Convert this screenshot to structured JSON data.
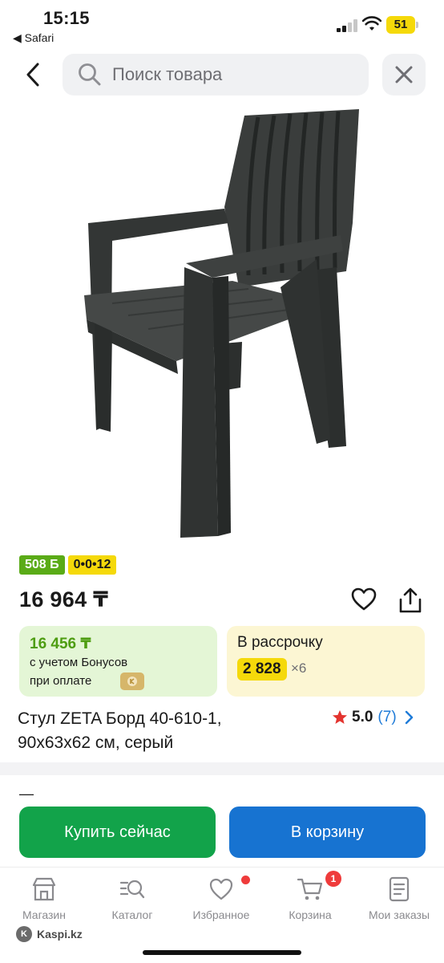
{
  "status_bar": {
    "time": "15:15",
    "back_app": "◀ Safari",
    "battery": "51"
  },
  "search": {
    "placeholder": "Поиск товара"
  },
  "badges": {
    "bonus": "508 Б",
    "installment": "0•0•12"
  },
  "price": "16 964 ₸",
  "bonus_card": {
    "price": "16 456 ₸",
    "note_line1": "с учетом Бонусов",
    "note_line2": "при оплате"
  },
  "installment_card": {
    "title": "В рассрочку",
    "amount": "2 828",
    "multiplier": "×6"
  },
  "product": {
    "title_line1": "Стул ZETA Борд 40-610-1,",
    "title_line2": "90x63x62 см, серый",
    "rating_value": "5.0",
    "rating_count": "(7)"
  },
  "sheet_dash": "—",
  "actions": {
    "buy_now": "Купить сейчас",
    "add_to_cart": "В корзину"
  },
  "tabbar": {
    "items": [
      {
        "label": "Магазин",
        "icon": "shop-icon"
      },
      {
        "label": "Каталог",
        "icon": "catalog-search-icon"
      },
      {
        "label": "Избранное",
        "icon": "heart-icon"
      },
      {
        "label": "Корзина",
        "icon": "cart-icon",
        "badge": "1"
      },
      {
        "label": "Мои заказы",
        "icon": "orders-icon"
      }
    ]
  },
  "site": "Kaspi.kz",
  "colors": {
    "accent_green": "#12a34a",
    "accent_blue": "#1773d1",
    "kaspi_yellow": "#f5d90a",
    "badge_red": "#ef3b3b"
  }
}
